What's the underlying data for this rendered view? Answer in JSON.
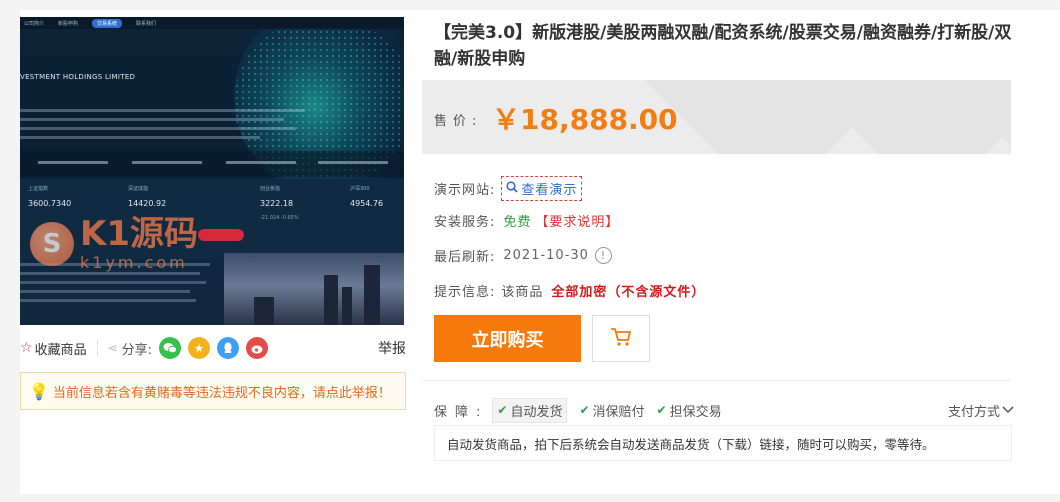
{
  "preview": {
    "nav_items": [
      "公司简介",
      "新股申购",
      "交易系统",
      "联系我们"
    ],
    "company_line": "VESTMENT HOLDINGS LIMITED",
    "stats": [
      {
        "label": "上证指数",
        "value": "3600.7340",
        "sub": ""
      },
      {
        "label": "深证成指",
        "value": "14420.92",
        "sub": ""
      },
      {
        "label": "创业板指",
        "value": "3222.18",
        "sub": "-21.024  -0.65%"
      },
      {
        "label": "沪深300",
        "value": "4954.76",
        "sub": ""
      }
    ],
    "watermark": {
      "logo": "S",
      "title": "K1源码",
      "url": "k1ym.com"
    }
  },
  "actions": {
    "favorite_label": "收藏商品",
    "share_label": "分享:",
    "report_label": "举报",
    "social_icons": [
      "wechat-icon",
      "qzone-icon",
      "qq-icon",
      "weibo-icon"
    ]
  },
  "notice": "当前信息若含有黄赌毒等违法违规不良内容，请点此举报！",
  "product": {
    "title": "【完美3.0】新版港股/美股两融双融/配资系统/股票交易/融资融券/打新股/双融/新股申购",
    "price_label": "售价:",
    "price": "￥18,888.00",
    "demo_label": "演示网站:",
    "demo_link": "查看演示",
    "install_label": "安装服务:",
    "install_value": "免费",
    "install_note": "【要求说明】",
    "refresh_label": "最后刷新:",
    "refresh_date": "2021-10-30",
    "tip_label": "提示信息:",
    "tip_prefix": "该商品",
    "tip_value": "全部加密（不含源文件）",
    "buy_label": "立即购买"
  },
  "guarantee": {
    "label": "保障:",
    "items": [
      "自动发货",
      "消保赔付",
      "担保交易"
    ],
    "payment_label": "支付方式",
    "description": "自动发货商品，拍下后系统会自动发送商品发货（下载）链接，随时可以购买，零等待。"
  },
  "colors": {
    "accent_orange": "#f7780b",
    "price": "#f47d12",
    "link": "#2f6fd0",
    "green": "#2f9e3c",
    "red": "#d61a1a"
  }
}
